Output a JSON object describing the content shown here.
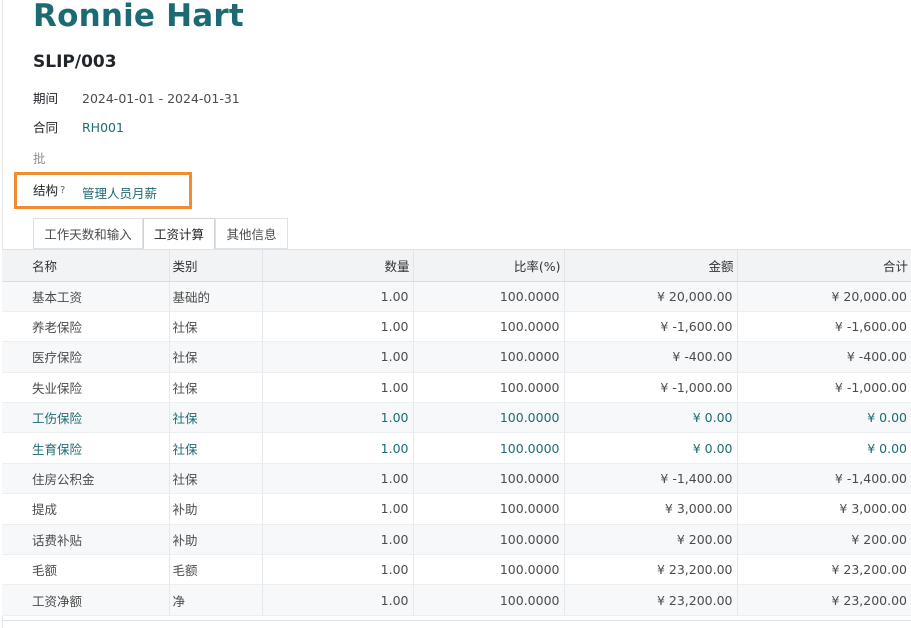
{
  "employee_name": "Ronnie Hart",
  "slip_ref": "SLIP/003",
  "fields": {
    "period": {
      "label": "期间",
      "value": "2024-01-01 - 2024-01-31"
    },
    "contract": {
      "label": "合同",
      "value": "RH001"
    },
    "batch": {
      "label": "批",
      "value": ""
    },
    "structure": {
      "label": "结构",
      "required_mark": "?",
      "value": "管理人员月薪"
    }
  },
  "tabs": [
    {
      "label": "工作天数和输入",
      "active": false
    },
    {
      "label": "工资计算",
      "active": true
    },
    {
      "label": "其他信息",
      "active": false
    }
  ],
  "table": {
    "headers": {
      "name": "名称",
      "category": "类别",
      "quantity": "数量",
      "rate": "比率(%)",
      "amount": "金额",
      "total": "合计"
    },
    "rows": [
      {
        "name": "基本工资",
        "category": "基础的",
        "quantity": "1.00",
        "rate": "100.0000",
        "amount": "¥ 20,000.00",
        "total": "¥ 20,000.00",
        "highlight": false
      },
      {
        "name": "养老保险",
        "category": "社保",
        "quantity": "1.00",
        "rate": "100.0000",
        "amount": "¥ -1,600.00",
        "total": "¥ -1,600.00",
        "highlight": false
      },
      {
        "name": "医疗保险",
        "category": "社保",
        "quantity": "1.00",
        "rate": "100.0000",
        "amount": "¥ -400.00",
        "total": "¥ -400.00",
        "highlight": false
      },
      {
        "name": "失业保险",
        "category": "社保",
        "quantity": "1.00",
        "rate": "100.0000",
        "amount": "¥ -1,000.00",
        "total": "¥ -1,000.00",
        "highlight": false
      },
      {
        "name": "工伤保险",
        "category": "社保",
        "quantity": "1.00",
        "rate": "100.0000",
        "amount": "¥ 0.00",
        "total": "¥ 0.00",
        "highlight": true
      },
      {
        "name": "生育保险",
        "category": "社保",
        "quantity": "1.00",
        "rate": "100.0000",
        "amount": "¥ 0.00",
        "total": "¥ 0.00",
        "highlight": true
      },
      {
        "name": "住房公积金",
        "category": "社保",
        "quantity": "1.00",
        "rate": "100.0000",
        "amount": "¥ -1,400.00",
        "total": "¥ -1,400.00",
        "highlight": false
      },
      {
        "name": "提成",
        "category": "补助",
        "quantity": "1.00",
        "rate": "100.0000",
        "amount": "¥ 3,000.00",
        "total": "¥ 3,000.00",
        "highlight": false
      },
      {
        "name": "话费补贴",
        "category": "补助",
        "quantity": "1.00",
        "rate": "100.0000",
        "amount": "¥ 200.00",
        "total": "¥ 200.00",
        "highlight": false
      },
      {
        "name": "毛额",
        "category": "毛额",
        "quantity": "1.00",
        "rate": "100.0000",
        "amount": "¥ 23,200.00",
        "total": "¥ 23,200.00",
        "highlight": false
      },
      {
        "name": "工资净额",
        "category": "净",
        "quantity": "1.00",
        "rate": "100.0000",
        "amount": "¥ 23,200.00",
        "total": "¥ 23,200.00",
        "highlight": false
      }
    ]
  },
  "colors": {
    "brand": "#1d6b72",
    "highlight_box": "#ef8d33"
  }
}
